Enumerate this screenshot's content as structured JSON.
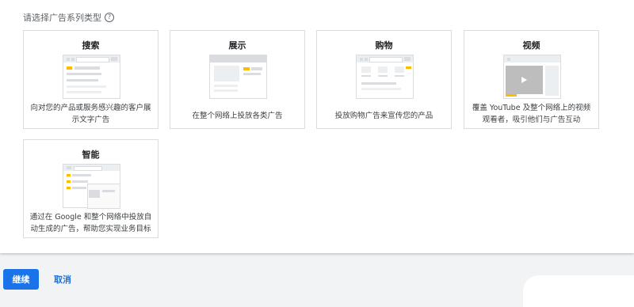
{
  "heading": {
    "text": "请选择广告系列类型",
    "help_icon": "?"
  },
  "cards": [
    {
      "title": "搜索",
      "description": "向对您的产品或服务感兴趣的客户展示文字广告",
      "icon": "search-ad-illustration"
    },
    {
      "title": "展示",
      "description": "在整个网络上投放各类广告",
      "icon": "display-ad-illustration"
    },
    {
      "title": "购物",
      "description": "投放购物广告来宣传您的产品",
      "icon": "shopping-ad-illustration"
    },
    {
      "title": "视频",
      "description": "覆盖 YouTube 及整个网络上的视频观看者，吸引他们与广告互动",
      "icon": "video-ad-illustration"
    },
    {
      "title": "智能",
      "description": "通过在 Google 和整个网络中投放自动生成的广告，帮助您实现业务目标",
      "icon": "smart-ad-illustration"
    }
  ],
  "actions": {
    "continue_label": "继续",
    "cancel_label": "取消"
  },
  "colors": {
    "accent": "#1a73e8",
    "highlight": "#fbbc04",
    "border": "#dadce0"
  }
}
